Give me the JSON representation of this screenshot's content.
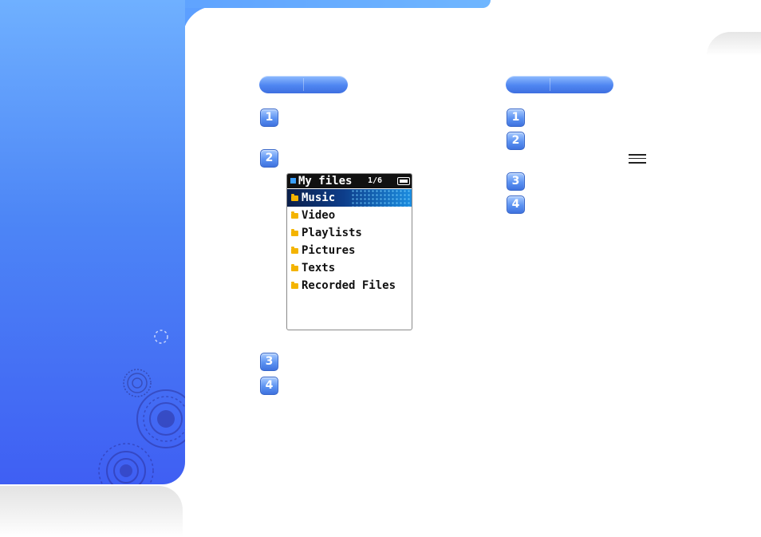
{
  "screen": {
    "header_title": "My files",
    "header_count": "1/6",
    "items": [
      {
        "label": "Music",
        "selected": true
      },
      {
        "label": "Video",
        "selected": false
      },
      {
        "label": "Playlists",
        "selected": false
      },
      {
        "label": "Pictures",
        "selected": false
      },
      {
        "label": "Texts",
        "selected": false
      },
      {
        "label": "Recorded Files",
        "selected": false
      }
    ]
  },
  "steps": {
    "left": [
      "1",
      "2",
      "3",
      "4"
    ],
    "right": [
      "1",
      "2",
      "3",
      "4"
    ]
  },
  "icons": {
    "menu": "menu-button-icon",
    "folder": "folder-icon",
    "battery": "battery-icon"
  },
  "colors": {
    "sidebar_top": "#6fb0ff",
    "sidebar_bottom": "#3f5ff3",
    "accent": "#4f86f1",
    "selected_row": "#0d3d8a",
    "folder": "#f4b400"
  }
}
